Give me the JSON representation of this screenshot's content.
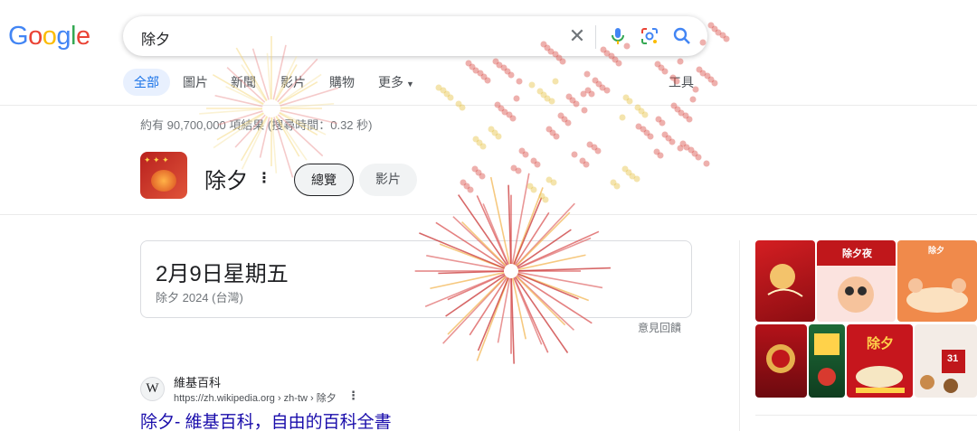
{
  "logo": {
    "letters": [
      "G",
      "o",
      "o",
      "g",
      "l",
      "e"
    ],
    "colors": [
      "#4285f4",
      "#ea4335",
      "#fbbc05",
      "#4285f4",
      "#34a853",
      "#ea4335"
    ]
  },
  "search": {
    "query": "除夕",
    "clear_icon": "close-icon",
    "mic_icon": "mic-icon",
    "lens_icon": "lens-icon",
    "search_icon": "search-icon"
  },
  "tabs": [
    {
      "label": "全部",
      "active": true
    },
    {
      "label": "圖片",
      "active": false
    },
    {
      "label": "新聞",
      "active": false
    },
    {
      "label": "影片",
      "active": false
    },
    {
      "label": "購物",
      "active": false
    },
    {
      "label": "更多",
      "active": false,
      "icon": "caret-down-icon"
    }
  ],
  "tools_label": "工具",
  "stats": "約有 90,700,000 項結果 (搜尋時間：0.32 秒)",
  "entity": {
    "title": "除夕",
    "more_icon": "more-vert-icon",
    "chips": [
      "總覽",
      "影片"
    ]
  },
  "answer": {
    "main": "2月9日星期五",
    "sub": "除夕 2024 (台灣)",
    "feedback": "意見回饋"
  },
  "result": {
    "favicon": "W",
    "site_name": "維基百科",
    "url": "https://zh.wikipedia.org › zh-tw › 除夕",
    "more_icon": "more-vert-icon",
    "title": "除夕- 維基百科，自由的百科全書"
  },
  "side_images": [
    {
      "caption": "",
      "color": "#c0171b"
    },
    {
      "caption": "除夕夜",
      "color": "#f6c9c9"
    },
    {
      "caption": "除夕",
      "color": "#e8703a"
    },
    {
      "caption": "",
      "color": "#a8101a"
    },
    {
      "caption": "",
      "color": "#1e6b38"
    },
    {
      "caption": "除夕",
      "color": "#c6161d"
    },
    {
      "caption": "",
      "color": "#f0e0d6"
    },
    {
      "caption": "31",
      "color": "#f6f2ef"
    }
  ]
}
